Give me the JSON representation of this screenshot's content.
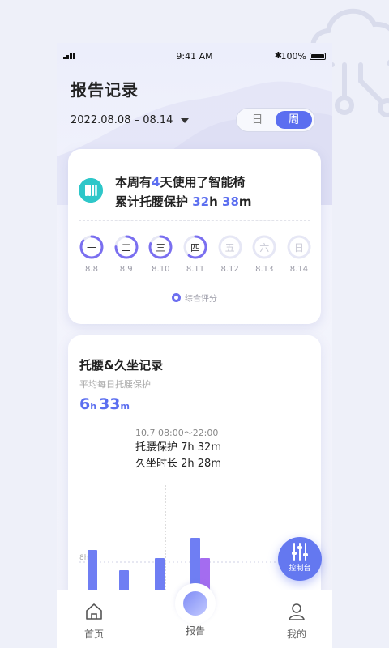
{
  "status": {
    "time": "9:41 AM",
    "battery": "100%"
  },
  "page": {
    "title": "报告记录",
    "date_range": "2022.08.08 – 08.14"
  },
  "segment": {
    "day": "日",
    "week": "周",
    "selected": "周"
  },
  "summary": {
    "line1_prefix": "本周有",
    "line1_days": "4",
    "line1_suffix": "天使用了智能椅",
    "line2_prefix": "累计托腰保护 ",
    "hours": "32",
    "h": "h",
    "minutes": "38",
    "m": "m"
  },
  "week_days": [
    {
      "label": "一",
      "date": "8.8",
      "score": 0.85
    },
    {
      "label": "二",
      "date": "8.9",
      "score": 0.75
    },
    {
      "label": "三",
      "date": "8.10",
      "score": 0.8
    },
    {
      "label": "四",
      "date": "8.11",
      "score": 0.6
    },
    {
      "label": "五",
      "date": "8.12",
      "score": 0
    },
    {
      "label": "六",
      "date": "8.13",
      "score": 0
    },
    {
      "label": "日",
      "date": "8.14",
      "score": 0
    }
  ],
  "legend": "综合评分",
  "record": {
    "title": "托腰&久坐记录",
    "subtitle": "平均每日托腰保护",
    "avg_h": "6",
    "h": "h",
    "avg_m": "33",
    "m": "m",
    "tooltip": {
      "time": "10.7  08:00～22:00",
      "lumbar": "托腰保护 7h 32m",
      "sitting": "久坐时长 2h 28m"
    },
    "ref_label": "8h"
  },
  "chart_data": {
    "type": "bar",
    "ref_line": 8,
    "series": [
      {
        "values": [
          9.5,
          7.0,
          8.5,
          11.0
        ]
      },
      {
        "values": [
          0,
          0,
          2.0,
          8.5
        ]
      }
    ],
    "colors": [
      "#6f7ef3",
      "#a46cf0"
    ]
  },
  "fab": {
    "label": "控制台"
  },
  "tabs": {
    "home": "首页",
    "report": "报告",
    "mine": "我的"
  }
}
